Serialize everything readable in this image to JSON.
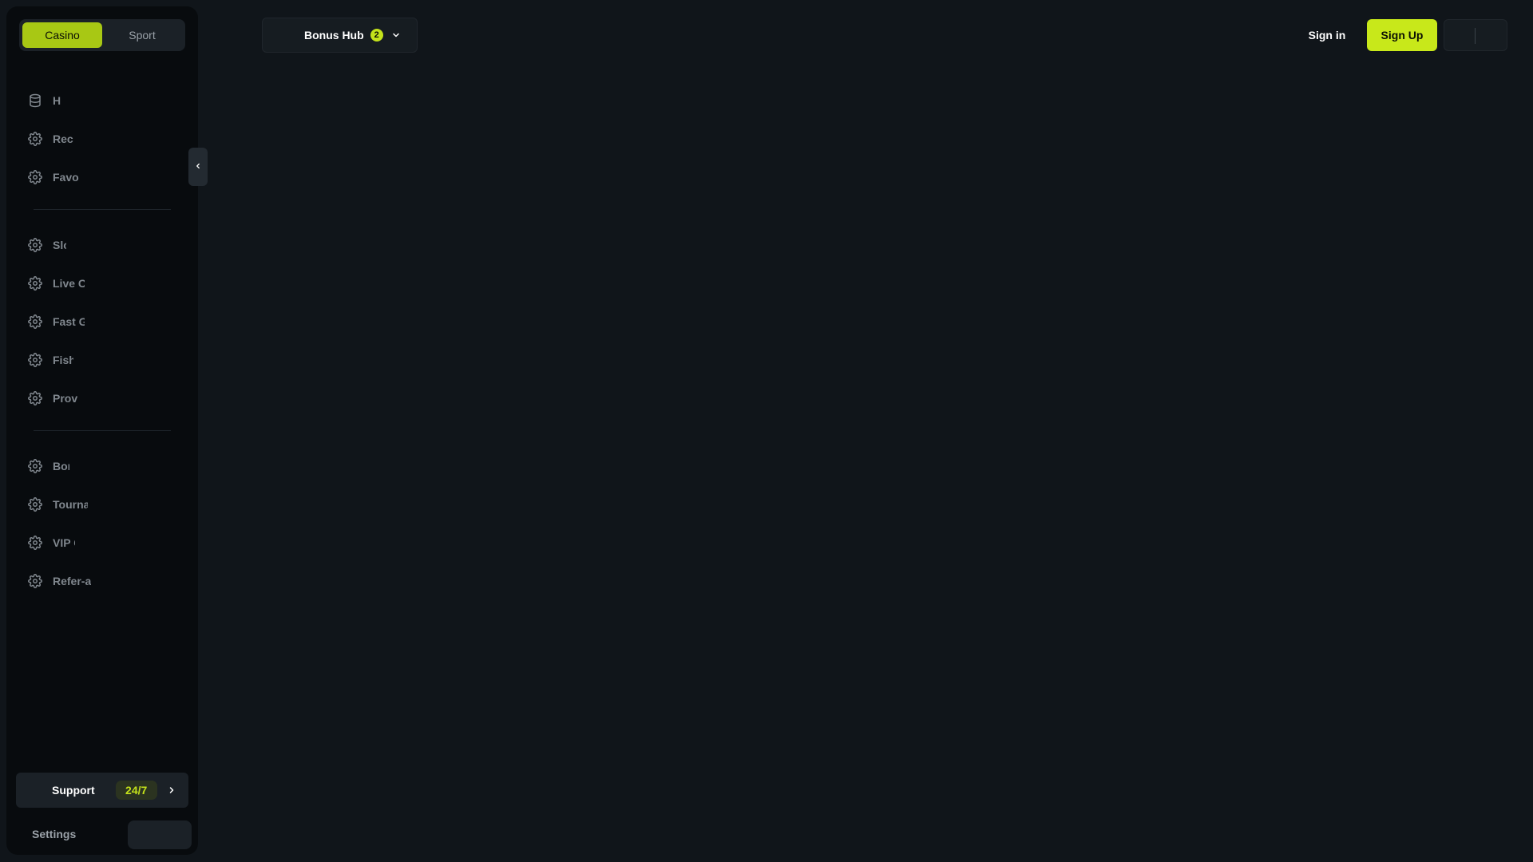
{
  "sidebar": {
    "mode_switch": {
      "casino": "Casino",
      "sport": "Sport",
      "active": "casino"
    },
    "group1": [
      {
        "label": "H",
        "icon": "database-icon"
      },
      {
        "label": "Rec",
        "icon": "gear-icon"
      },
      {
        "label": "Favo",
        "icon": "gear-icon"
      }
    ],
    "group2": [
      {
        "label": "Slo",
        "icon": "gear-icon"
      },
      {
        "label": "Live C",
        "icon": "gear-icon"
      },
      {
        "label": "Fast G",
        "icon": "gear-icon"
      },
      {
        "label": "Fish",
        "icon": "gear-icon"
      },
      {
        "label": "Prov",
        "icon": "gear-icon"
      }
    ],
    "group3": [
      {
        "label": "Bon",
        "icon": "gear-icon"
      },
      {
        "label": "Tourna",
        "icon": "gear-icon"
      },
      {
        "label": "VIP C",
        "icon": "gear-icon"
      },
      {
        "label": "Refer-a",
        "icon": "gear-icon"
      }
    ],
    "support": {
      "label": "Support",
      "badge": "24/7"
    },
    "settings": {
      "label": "Settings"
    }
  },
  "header": {
    "bonus_hub": {
      "label": "Bonus Hub",
      "count": "2"
    },
    "sign_in": "Sign in",
    "sign_up": "Sign Up"
  },
  "colors": {
    "accent": "#c8e81a",
    "background": "#10151a",
    "sidebar": "#080b0e"
  }
}
